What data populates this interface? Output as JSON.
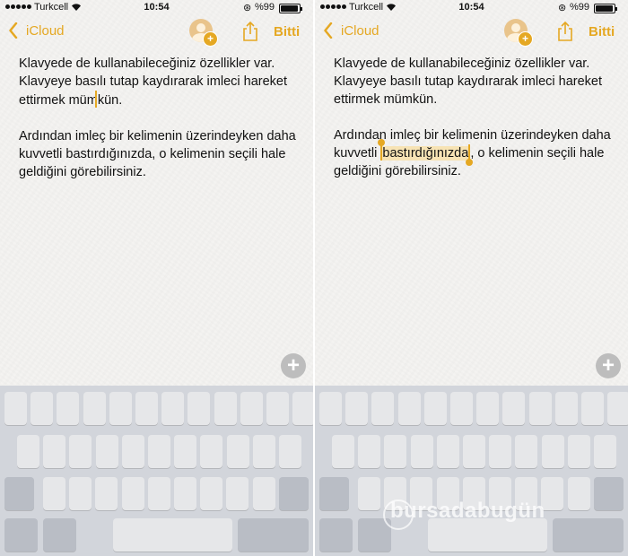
{
  "status_bar": {
    "carrier": "Turkcell",
    "time": "10:54",
    "battery": "%99"
  },
  "nav": {
    "back_label": "iCloud",
    "done_label": "Bitti"
  },
  "note": {
    "p1_a": "Klavyede de kullanabileceğiniz özellikler var. Klavyeye basılı tutap kaydırarak imleci hareket ettirmek müm",
    "p1_b": "kün.",
    "p1_full": "Klavyede de kullanabileceğiniz özellikler var. Klavyeye basılı tutap kaydırarak imleci hareket ettirmek mümkün.",
    "p2_full": "Ardından imleç bir kelimenin üzerindeyken daha kuvvetli bastırdığınızda, o kelimenin seçili hale geldiğini görebilirsiniz.",
    "p2_before": "Ardından imleç bir kelimenin üzerindeyken daha kuvvetli ",
    "p2_selected": "bastırdığınızda",
    "p2_after": ", o kelimenin seçili hale geldiğini görebilirsiniz."
  },
  "add_button": "+",
  "watermark": "bursadabugün",
  "colors": {
    "accent": "#e5a823",
    "selection": "#f7e3b4",
    "keyboard_bg": "#d2d5db",
    "key": "#e6e7e9"
  },
  "icons": [
    "signal-dots",
    "wifi-icon",
    "lock-rotation-icon",
    "battery-icon",
    "chevron-left-icon",
    "add-person-icon",
    "share-icon",
    "plus-icon"
  ]
}
